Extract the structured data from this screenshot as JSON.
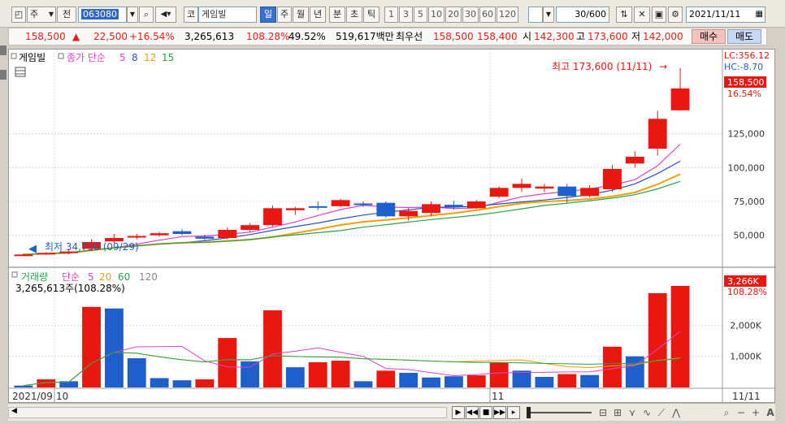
{
  "toolbar": {
    "market_label": "주",
    "prev_label": "전",
    "code": "063080",
    "market_type": "코",
    "stock_name": "게임빌",
    "period_day": "일",
    "period_week": "주",
    "period_month": "월",
    "period_year": "년",
    "period_min": "분",
    "period_sec": "초",
    "period_tick": "틱",
    "intervals": [
      "1",
      "3",
      "5",
      "10",
      "20",
      "30",
      "60",
      "120"
    ],
    "count_value": "30",
    "count_total": "/600",
    "date": "2021/11/11"
  },
  "info": {
    "price": "158,500",
    "arrow": "▲",
    "change": "22,500",
    "change_pct": "+16.54%",
    "volume": "3,265,613",
    "vol_ratio": "108.28%",
    "turnover": "49.52%",
    "amount": "519,617백만",
    "prior_label": "최우선",
    "ask": "158,500",
    "bid": "158,400",
    "open_label": "시",
    "open": "142,300",
    "high_label": "고",
    "high": "173,600",
    "low_label": "저",
    "low": "142,000",
    "buy_button": "매수",
    "sell_button": "매도"
  },
  "price_panel": {
    "legend_name": "게임빌",
    "legend_ma_label": "종가 단순",
    "legend_ma": [
      "5",
      "8",
      "12",
      "15"
    ],
    "lc": "LC:356.12",
    "hc": "HC:-8.70",
    "last_price": "158,500",
    "last_pct": "16.54%",
    "high_annotation": "최고 173,600 (11/11)",
    "low_annotation": "최저 34,750 (09/29)"
  },
  "volume_panel": {
    "legend_name": "거래량",
    "legend_label": "단순",
    "legend_ma": [
      "5",
      "20",
      "60",
      "120"
    ],
    "current": "3,265,613주(108.28%)",
    "last_volume": "3,266K",
    "last_pct": "108.28%"
  },
  "x_axis": {
    "start": "2021/09",
    "oct": "10",
    "nov": "11",
    "end": "11/11"
  },
  "colors": {
    "up": "#e8170f",
    "down": "#1f5fcc",
    "ma5": "#e040c8",
    "ma8": "#2a50c0",
    "ma12": "#f0a000",
    "ma15": "#2aa04a"
  },
  "chart_data": [
    {
      "type": "candlestick",
      "x_range": [
        "2021/09/29",
        "2021/11/11"
      ],
      "ylim": [
        30000,
        180000
      ],
      "y_ticks": [
        50000,
        75000,
        100000,
        125000
      ],
      "y_tick_labels": [
        "50,000",
        "75,000",
        "100,000",
        "125,000"
      ],
      "candles": [
        {
          "o": 35500,
          "h": 36500,
          "l": 34750,
          "c": 35800,
          "dir": "up"
        },
        {
          "o": 36000,
          "h": 37500,
          "l": 35500,
          "c": 37000,
          "dir": "up"
        },
        {
          "o": 37500,
          "h": 40000,
          "l": 36000,
          "c": 38000,
          "dir": "up"
        },
        {
          "o": 40000,
          "h": 47000,
          "l": 38500,
          "c": 45000,
          "dir": "up"
        },
        {
          "o": 45500,
          "h": 51000,
          "l": 44000,
          "c": 48000,
          "dir": "up"
        },
        {
          "o": 48500,
          "h": 51000,
          "l": 47000,
          "c": 49500,
          "dir": "up"
        },
        {
          "o": 50000,
          "h": 52500,
          "l": 49000,
          "c": 51500,
          "dir": "up"
        },
        {
          "o": 53000,
          "h": 54500,
          "l": 50000,
          "c": 51000,
          "dir": "down"
        },
        {
          "o": 49000,
          "h": 50500,
          "l": 46500,
          "c": 47500,
          "dir": "down"
        },
        {
          "o": 48000,
          "h": 56000,
          "l": 47000,
          "c": 54000,
          "dir": "up"
        },
        {
          "o": 54000,
          "h": 59000,
          "l": 52500,
          "c": 57500,
          "dir": "up"
        },
        {
          "o": 57500,
          "h": 72000,
          "l": 56500,
          "c": 70000,
          "dir": "up"
        },
        {
          "o": 68500,
          "h": 71000,
          "l": 65000,
          "c": 70000,
          "dir": "up"
        },
        {
          "o": 71000,
          "h": 75000,
          "l": 68500,
          "c": 71500,
          "dir": "down"
        },
        {
          "o": 71500,
          "h": 77000,
          "l": 71000,
          "c": 76000,
          "dir": "up"
        },
        {
          "o": 73500,
          "h": 75000,
          "l": 71000,
          "c": 73000,
          "dir": "down"
        },
        {
          "o": 74000,
          "h": 75000,
          "l": 63000,
          "c": 64000,
          "dir": "down"
        },
        {
          "o": 64000,
          "h": 70000,
          "l": 61000,
          "c": 68000,
          "dir": "up"
        },
        {
          "o": 66500,
          "h": 75000,
          "l": 64000,
          "c": 73000,
          "dir": "up"
        },
        {
          "o": 72500,
          "h": 75500,
          "l": 69000,
          "c": 71000,
          "dir": "down"
        },
        {
          "o": 70000,
          "h": 76000,
          "l": 69500,
          "c": 75000,
          "dir": "up"
        },
        {
          "o": 78500,
          "h": 86000,
          "l": 77500,
          "c": 85000,
          "dir": "up"
        },
        {
          "o": 85000,
          "h": 92000,
          "l": 82000,
          "c": 88000,
          "dir": "up"
        },
        {
          "o": 86000,
          "h": 88000,
          "l": 82000,
          "c": 84500,
          "dir": "up"
        },
        {
          "o": 86000,
          "h": 88000,
          "l": 74000,
          "c": 79000,
          "dir": "down"
        },
        {
          "o": 79000,
          "h": 87000,
          "l": 78000,
          "c": 85000,
          "dir": "up"
        },
        {
          "o": 84000,
          "h": 102000,
          "l": 82000,
          "c": 99000,
          "dir": "up"
        },
        {
          "o": 103000,
          "h": 112000,
          "l": 100000,
          "c": 108000,
          "dir": "up"
        },
        {
          "o": 114000,
          "h": 142000,
          "l": 109000,
          "c": 136000,
          "dir": "up"
        },
        {
          "o": 142300,
          "h": 173600,
          "l": 142000,
          "c": 158500,
          "dir": "up"
        }
      ]
    },
    {
      "type": "bar",
      "ylim": [
        0,
        3500
      ],
      "y_ticks": [
        1000,
        2000
      ],
      "y_tick_labels": [
        "1,000K",
        "2,000K"
      ],
      "values_k": [
        60,
        260,
        200,
        2590,
        2540,
        940,
        300,
        230,
        260,
        1590,
        840,
        2480,
        650,
        810,
        860,
        200,
        540,
        470,
        320,
        360,
        390,
        800,
        540,
        340,
        430,
        400,
        1310,
        1000,
        3030,
        3266
      ],
      "dirs": [
        "down",
        "up",
        "down",
        "up",
        "down",
        "down",
        "down",
        "down",
        "up",
        "up",
        "down",
        "up",
        "down",
        "up",
        "up",
        "down",
        "up",
        "down",
        "down",
        "down",
        "up",
        "up",
        "down",
        "down",
        "up",
        "down",
        "up",
        "down",
        "up",
        "up"
      ]
    }
  ]
}
